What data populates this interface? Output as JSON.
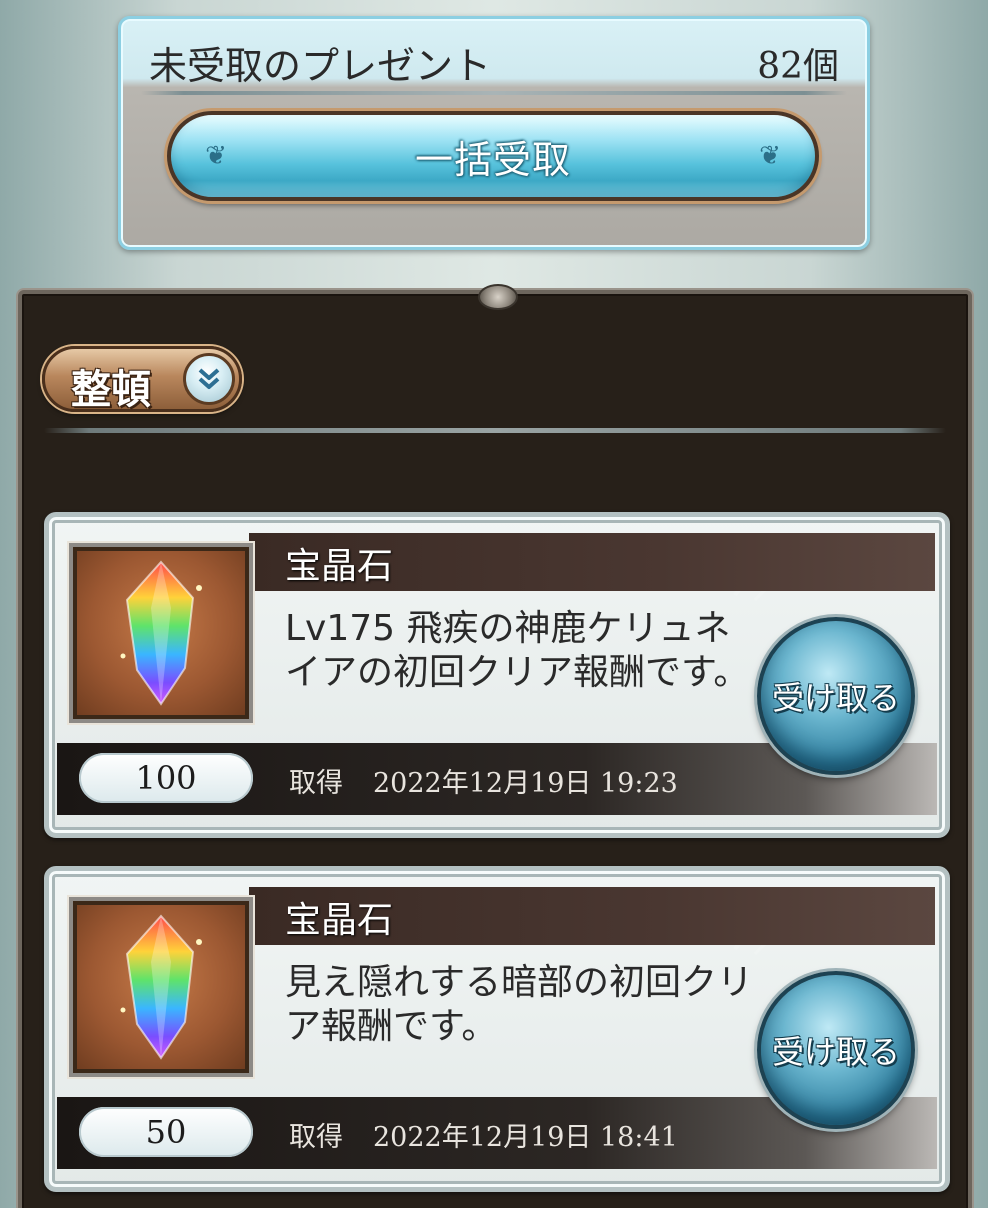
{
  "present_panel": {
    "title": "未受取のプレゼント",
    "count": "82個",
    "bulk_receive_label": "一括受取"
  },
  "list": {
    "sort_label": "整頓",
    "items": [
      {
        "name": "宝晶石",
        "description": "Lv175 飛疾の神鹿ケリュネイアの初回クリア報酬です。",
        "quantity": "100",
        "acquired_label": "取得",
        "acquired_date": "2022年12月19日 19:23",
        "receive_label": "受け取る",
        "icon": "rainbow-crystal-icon"
      },
      {
        "name": "宝晶石",
        "description": "見え隠れする暗部の初回クリア報酬です。",
        "quantity": "50",
        "acquired_label": "取得",
        "acquired_date": "2022年12月19日 18:41",
        "receive_label": "受け取る",
        "icon": "rainbow-crystal-icon"
      }
    ]
  },
  "colors": {
    "panel_accent": "#8ccfe2",
    "frame_background": "#272019",
    "receive_button": "#2f7f9f"
  }
}
